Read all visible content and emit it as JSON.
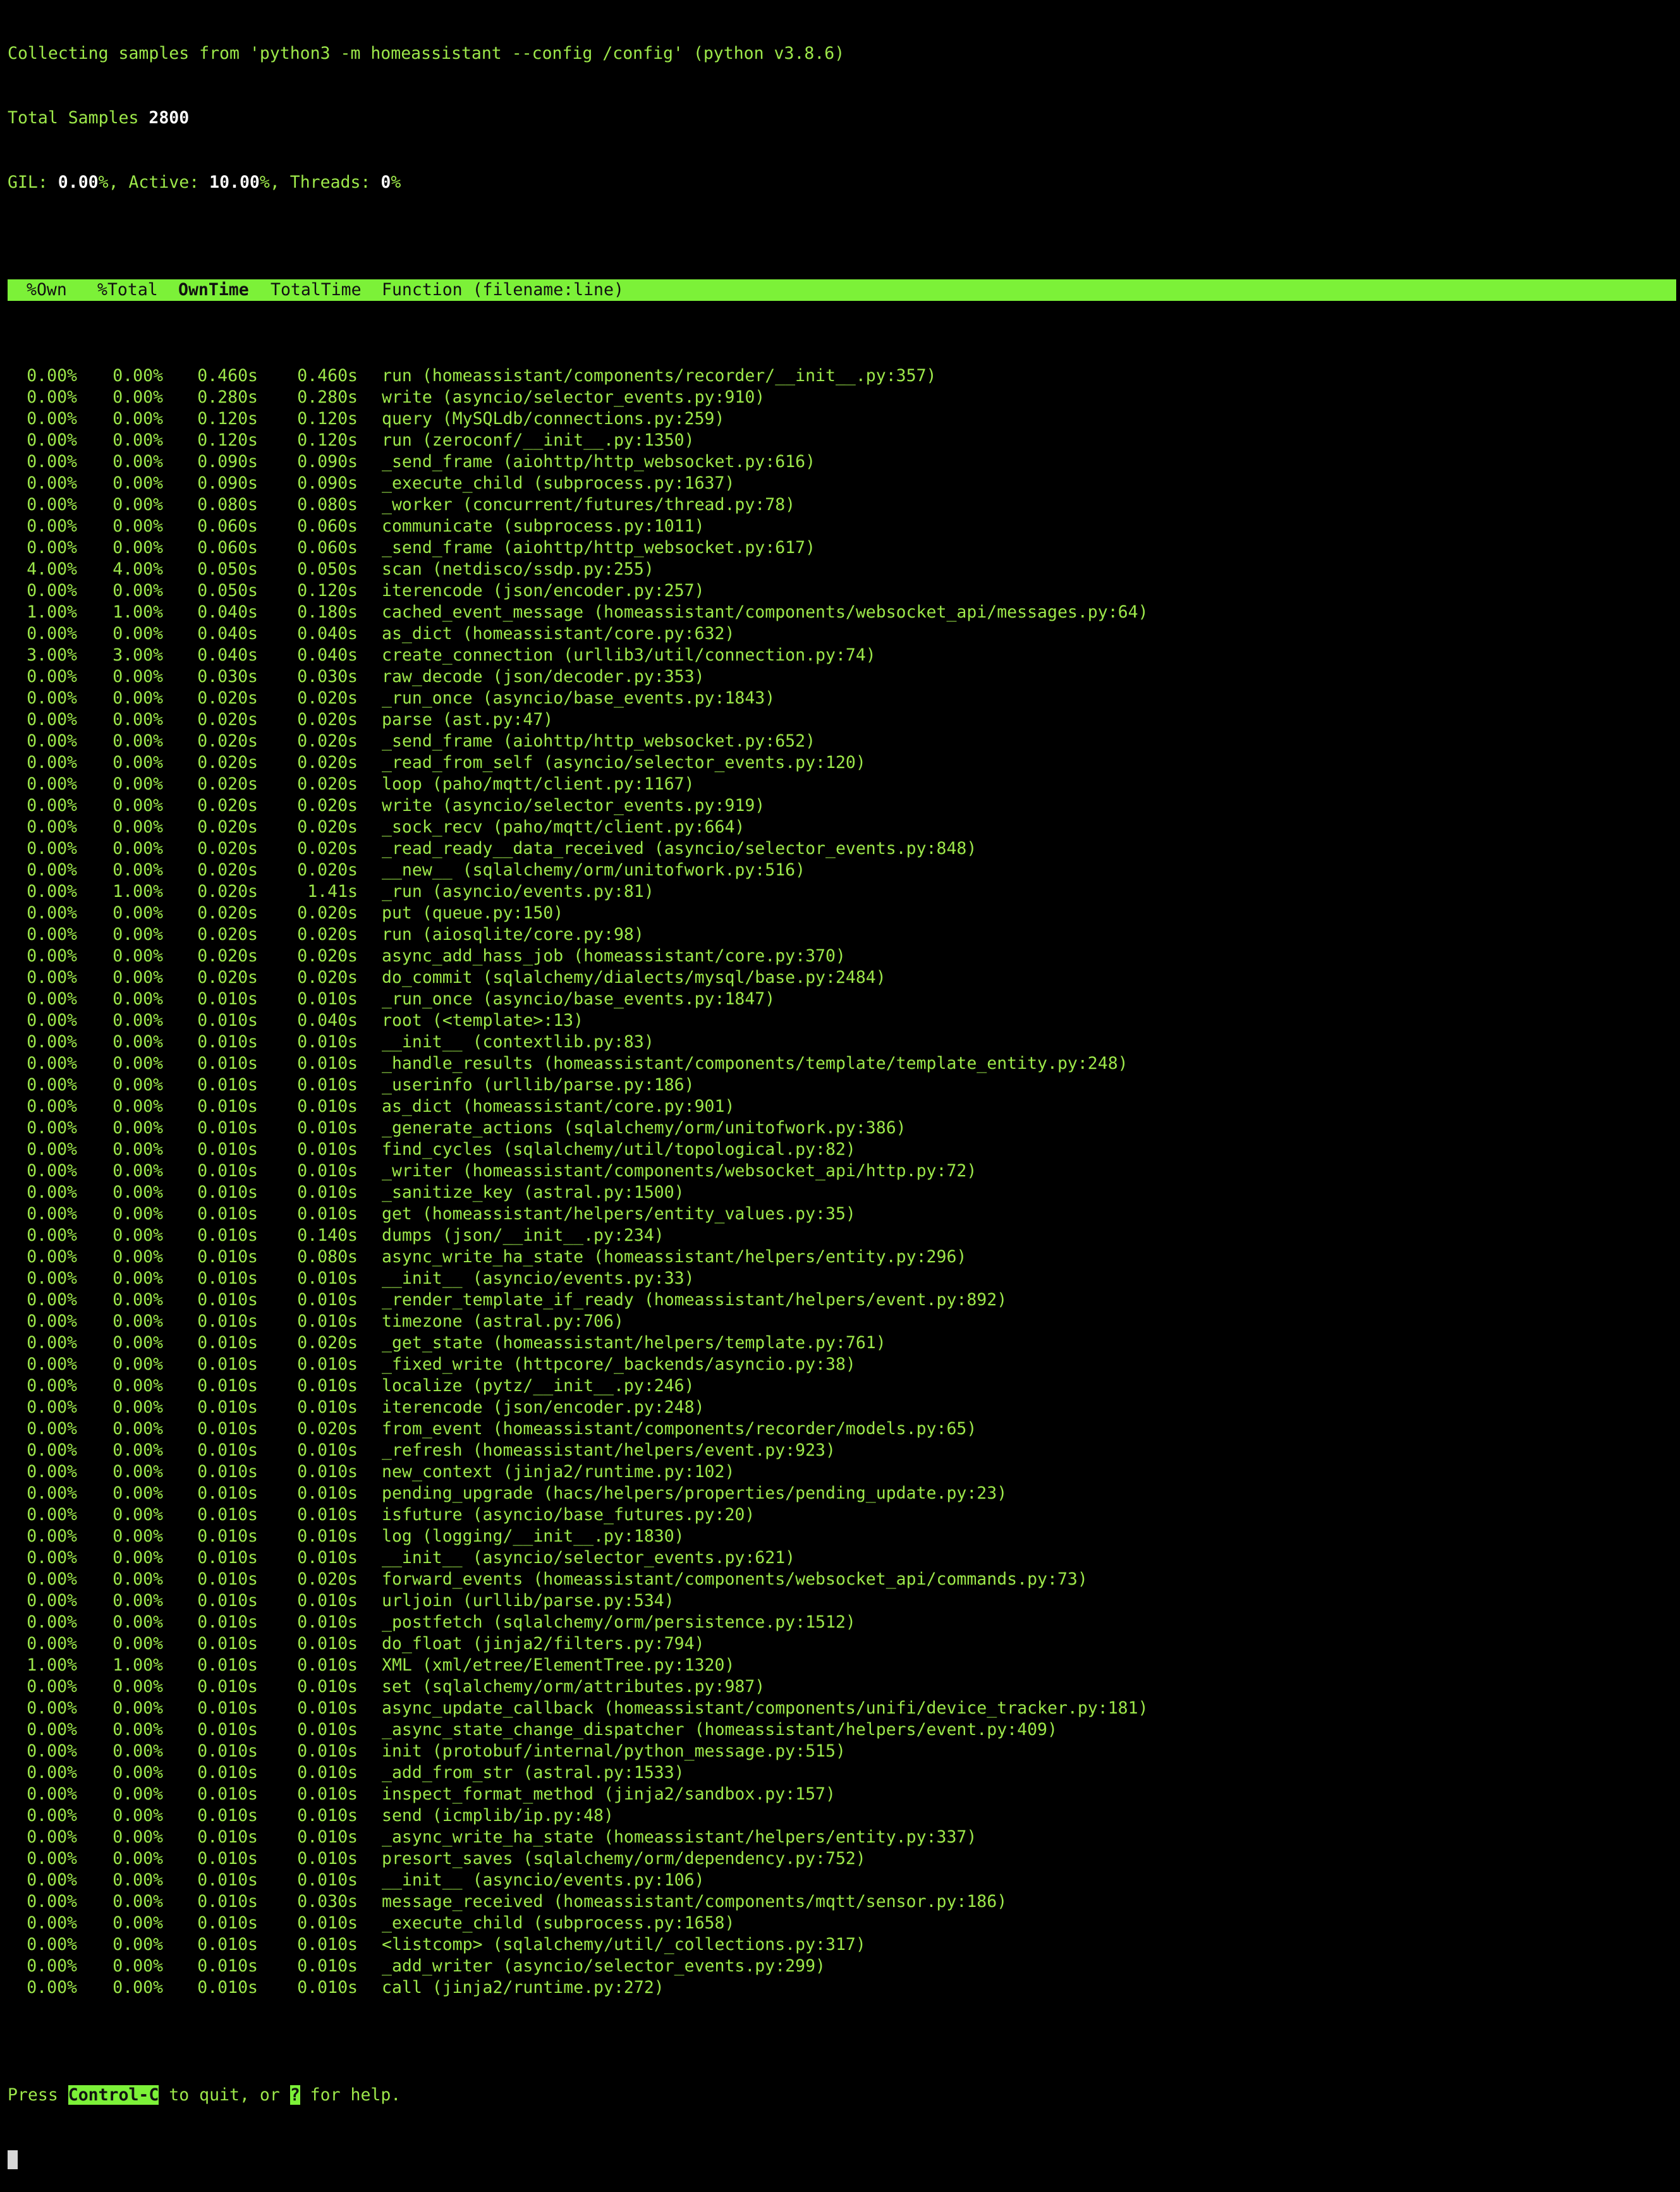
{
  "header": {
    "line1": "Collecting samples from 'python3 -m homeassistant --config /config' (python v3.8.6)",
    "samples_label": "Total Samples ",
    "samples_value": "2800",
    "gil_label": "GIL: ",
    "gil_value": "0.00",
    "active_label": "%, Active: ",
    "active_value": "10.00",
    "threads_label": "%, Threads: ",
    "threads_value": "0"
  },
  "columns": {
    "own": "%Own",
    "total": "%Total",
    "own_time": "OwnTime",
    "total_time": "TotalTime",
    "function": "Function (filename:line)"
  },
  "rows": [
    [
      "0.00%",
      "0.00%",
      "0.460s",
      "0.460s",
      "run (homeassistant/components/recorder/__init__.py:357)"
    ],
    [
      "0.00%",
      "0.00%",
      "0.280s",
      "0.280s",
      "write (asyncio/selector_events.py:910)"
    ],
    [
      "0.00%",
      "0.00%",
      "0.120s",
      "0.120s",
      "query (MySQLdb/connections.py:259)"
    ],
    [
      "0.00%",
      "0.00%",
      "0.120s",
      "0.120s",
      "run (zeroconf/__init__.py:1350)"
    ],
    [
      "0.00%",
      "0.00%",
      "0.090s",
      "0.090s",
      "_send_frame (aiohttp/http_websocket.py:616)"
    ],
    [
      "0.00%",
      "0.00%",
      "0.090s",
      "0.090s",
      "_execute_child (subprocess.py:1637)"
    ],
    [
      "0.00%",
      "0.00%",
      "0.080s",
      "0.080s",
      "_worker (concurrent/futures/thread.py:78)"
    ],
    [
      "0.00%",
      "0.00%",
      "0.060s",
      "0.060s",
      "communicate (subprocess.py:1011)"
    ],
    [
      "0.00%",
      "0.00%",
      "0.060s",
      "0.060s",
      "_send_frame (aiohttp/http_websocket.py:617)"
    ],
    [
      "4.00%",
      "4.00%",
      "0.050s",
      "0.050s",
      "scan (netdisco/ssdp.py:255)"
    ],
    [
      "0.00%",
      "0.00%",
      "0.050s",
      "0.120s",
      "iterencode (json/encoder.py:257)"
    ],
    [
      "1.00%",
      "1.00%",
      "0.040s",
      "0.180s",
      "cached_event_message (homeassistant/components/websocket_api/messages.py:64)"
    ],
    [
      "0.00%",
      "0.00%",
      "0.040s",
      "0.040s",
      "as_dict (homeassistant/core.py:632)"
    ],
    [
      "3.00%",
      "3.00%",
      "0.040s",
      "0.040s",
      "create_connection (urllib3/util/connection.py:74)"
    ],
    [
      "0.00%",
      "0.00%",
      "0.030s",
      "0.030s",
      "raw_decode (json/decoder.py:353)"
    ],
    [
      "0.00%",
      "0.00%",
      "0.020s",
      "0.020s",
      "_run_once (asyncio/base_events.py:1843)"
    ],
    [
      "0.00%",
      "0.00%",
      "0.020s",
      "0.020s",
      "parse (ast.py:47)"
    ],
    [
      "0.00%",
      "0.00%",
      "0.020s",
      "0.020s",
      "_send_frame (aiohttp/http_websocket.py:652)"
    ],
    [
      "0.00%",
      "0.00%",
      "0.020s",
      "0.020s",
      "_read_from_self (asyncio/selector_events.py:120)"
    ],
    [
      "0.00%",
      "0.00%",
      "0.020s",
      "0.020s",
      "loop (paho/mqtt/client.py:1167)"
    ],
    [
      "0.00%",
      "0.00%",
      "0.020s",
      "0.020s",
      "write (asyncio/selector_events.py:919)"
    ],
    [
      "0.00%",
      "0.00%",
      "0.020s",
      "0.020s",
      "_sock_recv (paho/mqtt/client.py:664)"
    ],
    [
      "0.00%",
      "0.00%",
      "0.020s",
      "0.020s",
      "_read_ready__data_received (asyncio/selector_events.py:848)"
    ],
    [
      "0.00%",
      "0.00%",
      "0.020s",
      "0.020s",
      "__new__ (sqlalchemy/orm/unitofwork.py:516)"
    ],
    [
      "0.00%",
      "1.00%",
      "0.020s",
      "1.41s",
      "_run (asyncio/events.py:81)"
    ],
    [
      "0.00%",
      "0.00%",
      "0.020s",
      "0.020s",
      "put (queue.py:150)"
    ],
    [
      "0.00%",
      "0.00%",
      "0.020s",
      "0.020s",
      "run (aiosqlite/core.py:98)"
    ],
    [
      "0.00%",
      "0.00%",
      "0.020s",
      "0.020s",
      "async_add_hass_job (homeassistant/core.py:370)"
    ],
    [
      "0.00%",
      "0.00%",
      "0.020s",
      "0.020s",
      "do_commit (sqlalchemy/dialects/mysql/base.py:2484)"
    ],
    [
      "0.00%",
      "0.00%",
      "0.010s",
      "0.010s",
      "_run_once (asyncio/base_events.py:1847)"
    ],
    [
      "0.00%",
      "0.00%",
      "0.010s",
      "0.040s",
      "root (<template>:13)"
    ],
    [
      "0.00%",
      "0.00%",
      "0.010s",
      "0.010s",
      "__init__ (contextlib.py:83)"
    ],
    [
      "0.00%",
      "0.00%",
      "0.010s",
      "0.010s",
      "_handle_results (homeassistant/components/template/template_entity.py:248)"
    ],
    [
      "0.00%",
      "0.00%",
      "0.010s",
      "0.010s",
      "_userinfo (urllib/parse.py:186)"
    ],
    [
      "0.00%",
      "0.00%",
      "0.010s",
      "0.010s",
      "as_dict (homeassistant/core.py:901)"
    ],
    [
      "0.00%",
      "0.00%",
      "0.010s",
      "0.010s",
      "_generate_actions (sqlalchemy/orm/unitofwork.py:386)"
    ],
    [
      "0.00%",
      "0.00%",
      "0.010s",
      "0.010s",
      "find_cycles (sqlalchemy/util/topological.py:82)"
    ],
    [
      "0.00%",
      "0.00%",
      "0.010s",
      "0.010s",
      "_writer (homeassistant/components/websocket_api/http.py:72)"
    ],
    [
      "0.00%",
      "0.00%",
      "0.010s",
      "0.010s",
      "_sanitize_key (astral.py:1500)"
    ],
    [
      "0.00%",
      "0.00%",
      "0.010s",
      "0.010s",
      "get (homeassistant/helpers/entity_values.py:35)"
    ],
    [
      "0.00%",
      "0.00%",
      "0.010s",
      "0.140s",
      "dumps (json/__init__.py:234)"
    ],
    [
      "0.00%",
      "0.00%",
      "0.010s",
      "0.080s",
      "async_write_ha_state (homeassistant/helpers/entity.py:296)"
    ],
    [
      "0.00%",
      "0.00%",
      "0.010s",
      "0.010s",
      "__init__ (asyncio/events.py:33)"
    ],
    [
      "0.00%",
      "0.00%",
      "0.010s",
      "0.010s",
      "_render_template_if_ready (homeassistant/helpers/event.py:892)"
    ],
    [
      "0.00%",
      "0.00%",
      "0.010s",
      "0.010s",
      "timezone (astral.py:706)"
    ],
    [
      "0.00%",
      "0.00%",
      "0.010s",
      "0.020s",
      "_get_state (homeassistant/helpers/template.py:761)"
    ],
    [
      "0.00%",
      "0.00%",
      "0.010s",
      "0.010s",
      "_fixed_write (httpcore/_backends/asyncio.py:38)"
    ],
    [
      "0.00%",
      "0.00%",
      "0.010s",
      "0.010s",
      "localize (pytz/__init__.py:246)"
    ],
    [
      "0.00%",
      "0.00%",
      "0.010s",
      "0.010s",
      "iterencode (json/encoder.py:248)"
    ],
    [
      "0.00%",
      "0.00%",
      "0.010s",
      "0.020s",
      "from_event (homeassistant/components/recorder/models.py:65)"
    ],
    [
      "0.00%",
      "0.00%",
      "0.010s",
      "0.010s",
      "_refresh (homeassistant/helpers/event.py:923)"
    ],
    [
      "0.00%",
      "0.00%",
      "0.010s",
      "0.010s",
      "new_context (jinja2/runtime.py:102)"
    ],
    [
      "0.00%",
      "0.00%",
      "0.010s",
      "0.010s",
      "pending_upgrade (hacs/helpers/properties/pending_update.py:23)"
    ],
    [
      "0.00%",
      "0.00%",
      "0.010s",
      "0.010s",
      "isfuture (asyncio/base_futures.py:20)"
    ],
    [
      "0.00%",
      "0.00%",
      "0.010s",
      "0.010s",
      "log (logging/__init__.py:1830)"
    ],
    [
      "0.00%",
      "0.00%",
      "0.010s",
      "0.010s",
      "__init__ (asyncio/selector_events.py:621)"
    ],
    [
      "0.00%",
      "0.00%",
      "0.010s",
      "0.020s",
      "forward_events (homeassistant/components/websocket_api/commands.py:73)"
    ],
    [
      "0.00%",
      "0.00%",
      "0.010s",
      "0.010s",
      "urljoin (urllib/parse.py:534)"
    ],
    [
      "0.00%",
      "0.00%",
      "0.010s",
      "0.010s",
      "_postfetch (sqlalchemy/orm/persistence.py:1512)"
    ],
    [
      "0.00%",
      "0.00%",
      "0.010s",
      "0.010s",
      "do_float (jinja2/filters.py:794)"
    ],
    [
      "1.00%",
      "1.00%",
      "0.010s",
      "0.010s",
      "XML (xml/etree/ElementTree.py:1320)"
    ],
    [
      "0.00%",
      "0.00%",
      "0.010s",
      "0.010s",
      "set (sqlalchemy/orm/attributes.py:987)"
    ],
    [
      "0.00%",
      "0.00%",
      "0.010s",
      "0.010s",
      "async_update_callback (homeassistant/components/unifi/device_tracker.py:181)"
    ],
    [
      "0.00%",
      "0.00%",
      "0.010s",
      "0.010s",
      "_async_state_change_dispatcher (homeassistant/helpers/event.py:409)"
    ],
    [
      "0.00%",
      "0.00%",
      "0.010s",
      "0.010s",
      "init (protobuf/internal/python_message.py:515)"
    ],
    [
      "0.00%",
      "0.00%",
      "0.010s",
      "0.010s",
      "_add_from_str (astral.py:1533)"
    ],
    [
      "0.00%",
      "0.00%",
      "0.010s",
      "0.010s",
      "inspect_format_method (jinja2/sandbox.py:157)"
    ],
    [
      "0.00%",
      "0.00%",
      "0.010s",
      "0.010s",
      "send (icmplib/ip.py:48)"
    ],
    [
      "0.00%",
      "0.00%",
      "0.010s",
      "0.010s",
      "_async_write_ha_state (homeassistant/helpers/entity.py:337)"
    ],
    [
      "0.00%",
      "0.00%",
      "0.010s",
      "0.010s",
      "presort_saves (sqlalchemy/orm/dependency.py:752)"
    ],
    [
      "0.00%",
      "0.00%",
      "0.010s",
      "0.010s",
      "__init__ (asyncio/events.py:106)"
    ],
    [
      "0.00%",
      "0.00%",
      "0.010s",
      "0.030s",
      "message_received (homeassistant/components/mqtt/sensor.py:186)"
    ],
    [
      "0.00%",
      "0.00%",
      "0.010s",
      "0.010s",
      "_execute_child (subprocess.py:1658)"
    ],
    [
      "0.00%",
      "0.00%",
      "0.010s",
      "0.010s",
      "<listcomp> (sqlalchemy/util/_collections.py:317)"
    ],
    [
      "0.00%",
      "0.00%",
      "0.010s",
      "0.010s",
      "_add_writer (asyncio/selector_events.py:299)"
    ],
    [
      "0.00%",
      "0.00%",
      "0.010s",
      "0.010s",
      "call (jinja2/runtime.py:272)"
    ]
  ],
  "footer": {
    "press": "Press ",
    "quit_key": "Control-C",
    "middle": " to quit, or ",
    "help_key": "?",
    "end": " for help."
  },
  "colors": {
    "background": "#000000",
    "text": "#9de84a",
    "highlight": "#7cf138"
  }
}
